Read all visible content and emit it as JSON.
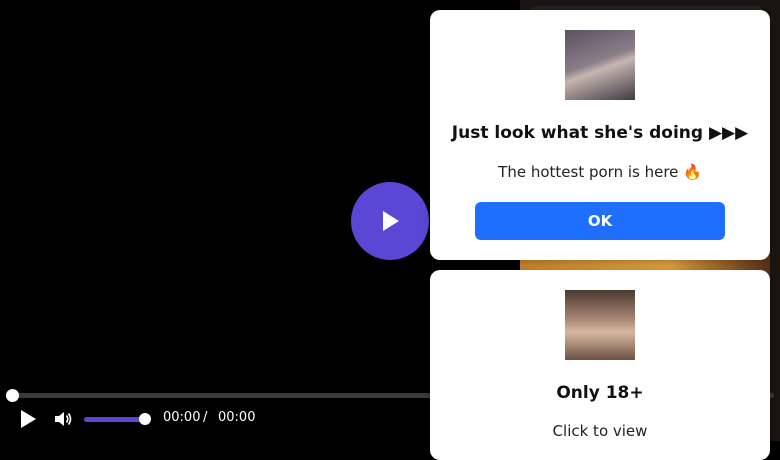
{
  "player": {
    "current_time": "00:00",
    "separator": "/",
    "duration": "00:00",
    "progress_fraction": 0,
    "volume_fraction": 1,
    "accent_color": "#5a47d6"
  },
  "popup_1": {
    "thumbnail_icon": "thumbnail-image",
    "title": "Just look what she's doing ▶▶▶",
    "subtitle": "The hottest porn is here 🔥",
    "button_label": "OK",
    "button_color": "#1f6fff"
  },
  "popup_2": {
    "thumbnail_icon": "thumbnail-image",
    "title": "Only 18+",
    "subtitle": "Click to view"
  }
}
